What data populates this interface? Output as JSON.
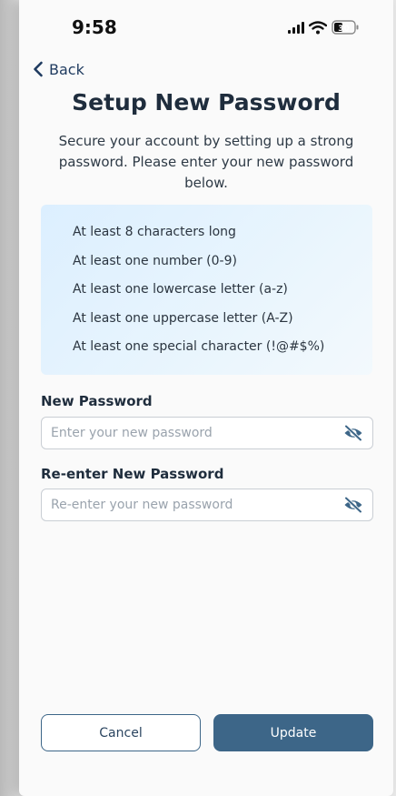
{
  "status_bar": {
    "time": "9:58",
    "battery": "30"
  },
  "nav": {
    "back_label": "Back"
  },
  "header": {
    "title": "Setup New Password",
    "subtitle": "Secure your account by setting up a strong password. Please enter your new password below."
  },
  "requirements": [
    "At least 8 characters long",
    "At least one number (0-9)",
    "At least one lowercase letter (a-z)",
    "At least one uppercase letter (A-Z)",
    "At least one special character (!@#$%)"
  ],
  "form": {
    "new_password": {
      "label": "New Password",
      "placeholder": "Enter your new password",
      "value": "",
      "toggle_icon": "eye-off-icon"
    },
    "confirm_password": {
      "label": "Re-enter New Password",
      "placeholder": "Re-enter your new password",
      "value": "",
      "toggle_icon": "eye-off-icon"
    }
  },
  "actions": {
    "cancel_label": "Cancel",
    "update_label": "Update"
  },
  "colors": {
    "primary": "#3d6688",
    "title_text": "#1f2d3d",
    "requirements_bg": "#e6f3fd"
  }
}
